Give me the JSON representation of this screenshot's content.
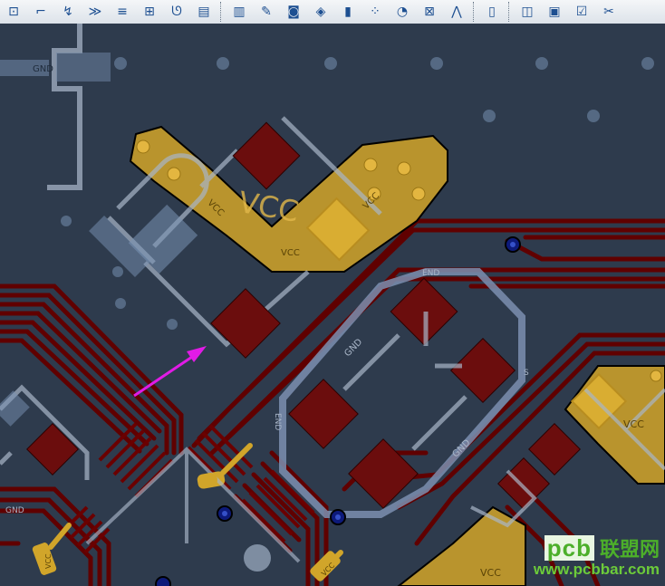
{
  "toolbar": {
    "buttons": [
      {
        "name": "place-component",
        "icon": "place-component-icon",
        "glyph": "⊡"
      },
      {
        "name": "place-track",
        "icon": "track-icon",
        "glyph": "⌐"
      },
      {
        "name": "interactive-route",
        "icon": "route-icon",
        "glyph": "↯"
      },
      {
        "name": "diff-pair",
        "icon": "diff-pair-icon",
        "glyph": "≫"
      },
      {
        "name": "bus-route",
        "icon": "bus-icon",
        "glyph": "≡"
      },
      {
        "name": "place-via",
        "icon": "via-array-icon",
        "glyph": "⊞"
      },
      {
        "name": "place-arc",
        "icon": "arc-icon",
        "glyph": "ᘎ"
      },
      {
        "name": "place-string",
        "icon": "string-icon",
        "glyph": "▤"
      },
      {
        "name": "library",
        "icon": "library-icon",
        "glyph": "▥"
      },
      {
        "name": "tools",
        "icon": "wrench-icon",
        "glyph": "✎"
      },
      {
        "name": "camera",
        "icon": "camera-icon",
        "glyph": "◙"
      },
      {
        "name": "speaker",
        "icon": "speaker-icon",
        "glyph": "◈"
      },
      {
        "name": "layers",
        "icon": "layer-icon",
        "glyph": "▮"
      },
      {
        "name": "grid",
        "icon": "grid-icon",
        "glyph": "⁘"
      },
      {
        "name": "measure",
        "icon": "measure-icon",
        "glyph": "◔"
      },
      {
        "name": "component-grid",
        "icon": "component-grid-icon",
        "glyph": "⊠"
      },
      {
        "name": "net-route",
        "icon": "net-icon",
        "glyph": "⋀"
      },
      {
        "name": "documents",
        "icon": "document-icon",
        "glyph": "▯"
      },
      {
        "name": "book",
        "icon": "book-icon",
        "glyph": "◫"
      },
      {
        "name": "board",
        "icon": "board-icon",
        "glyph": "▣"
      },
      {
        "name": "checklist",
        "icon": "checklist-icon",
        "glyph": "☑"
      },
      {
        "name": "more-tools",
        "icon": "tools-more-icon",
        "glyph": "✂"
      }
    ]
  },
  "labels": {
    "gnd": "GND",
    "vcc_big": "VCC",
    "vcc": "VCC",
    "end": "END",
    "s": "S"
  },
  "colors": {
    "background": "#2e3b4d",
    "copper_pour": "#d1a52a",
    "copper_outline": "#000000",
    "pad": "#6b0d0d",
    "silkscreen": "#b6c2d2",
    "via": "#0f1d8a",
    "trace": "#660000",
    "arrow": "#e11be6",
    "watermark": "#4caf2a"
  },
  "watermark": {
    "logo": "pcb",
    "cn": "联盟网",
    "url": "www.pcbbar.com"
  }
}
